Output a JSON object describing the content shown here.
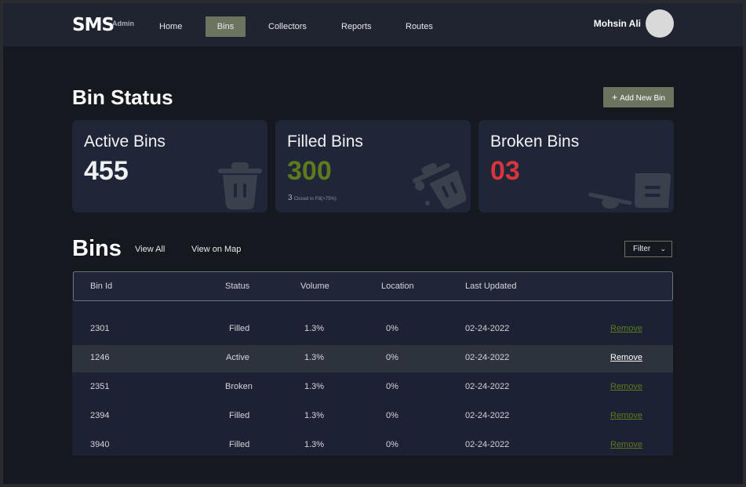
{
  "header": {
    "logo": "SMS",
    "logo_sub": "Admin",
    "nav": [
      {
        "label": "Home",
        "active": false
      },
      {
        "label": "Bins",
        "active": true
      },
      {
        "label": "Collectors",
        "active": false
      },
      {
        "label": "Reports",
        "active": false
      },
      {
        "label": "Routes",
        "active": false
      }
    ],
    "user_name": "Mohsin Ali"
  },
  "page": {
    "title": "Bin Status",
    "add_button": "Add New Bin"
  },
  "cards": [
    {
      "title": "Active Bins",
      "value": "455",
      "color": "#eef0f2",
      "icon": "trash-bin-icon"
    },
    {
      "title": "Filled Bins",
      "value": "300",
      "color": "#5d7a1f",
      "sub_num": "3",
      "sub_text": "Closed to Fill(>75%)",
      "icon": "tipped-bin-icon"
    },
    {
      "title": "Broken Bins",
      "value": "03",
      "color": "#d6353d",
      "icon": "broken-bin-icon"
    }
  ],
  "bins": {
    "title": "Bins",
    "view_all": "View All",
    "view_on_map": "View on Map",
    "filter": "Filter",
    "columns": [
      "Bin Id",
      "Status",
      "Volume",
      "Location",
      "Last Updated"
    ],
    "rows": [
      {
        "id": "2301",
        "status": "Filled",
        "volume": "1.3%",
        "location": "0%",
        "updated": "02-24-2022",
        "action": "Remove"
      },
      {
        "id": "1246",
        "status": "Active",
        "volume": "1.3%",
        "location": "0%",
        "updated": "02-24-2022",
        "action": "Remove"
      },
      {
        "id": "2351",
        "status": "Broken",
        "volume": "1.3%",
        "location": "0%",
        "updated": "02-24-2022",
        "action": "Remove"
      },
      {
        "id": "2394",
        "status": "Filled",
        "volume": "1.3%",
        "location": "0%",
        "updated": "02-24-2022",
        "action": "Remove"
      },
      {
        "id": "3940",
        "status": "Filled",
        "volume": "1.3%",
        "location": "0%",
        "updated": "02-24-2022",
        "action": "Remove"
      }
    ]
  },
  "colors": {
    "accent": "#6c7460",
    "remove_link": "#5d7a1f",
    "remove_link_highlight": "#ffffff"
  }
}
